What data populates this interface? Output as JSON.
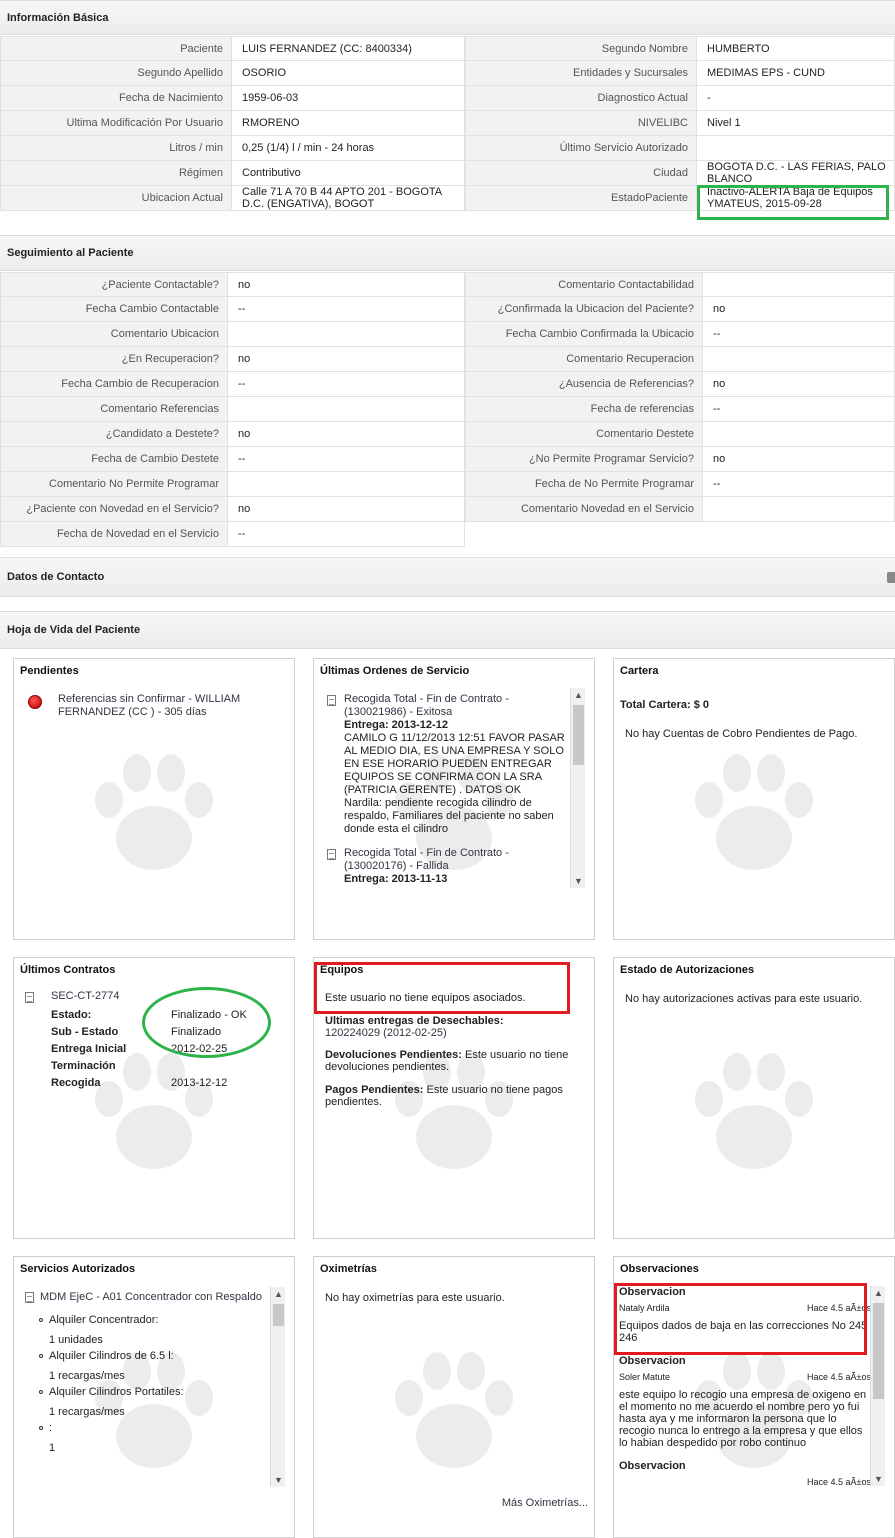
{
  "basic": {
    "header": "Información Básica",
    "rows": [
      {
        "l1": "Paciente",
        "v1": "LUIS FERNANDEZ (CC: 8400334)",
        "l2": "Segundo Nombre",
        "v2": "HUMBERTO"
      },
      {
        "l1": "Segundo Apellido",
        "v1": "OSORIO",
        "l2": "Entidades y Sucursales",
        "v2": "MEDIMAS EPS - CUND"
      },
      {
        "l1": "Fecha de Nacimiento",
        "v1": "1959-06-03",
        "l2": "Diagnostico Actual",
        "v2": "-"
      },
      {
        "l1": "Ultima Modificación Por Usuario",
        "v1": "RMORENO",
        "l2": "NIVELIBC",
        "v2": "Nivel 1"
      },
      {
        "l1": "Litros / min",
        "v1": "0,25 (1/4) l / min - 24 horas",
        "l2": "Último Servicio Autorizado",
        "v2": ""
      },
      {
        "l1": "Régimen",
        "v1": "Contributivo",
        "l2": "Ciudad",
        "v2": "BOGOTA D.C. - LAS FERIAS, PALO BLANCO"
      },
      {
        "l1": "Ubicacion Actual",
        "v1": "Calle 71 A 70 B 44 APTO 201 - BOGOTA D.C. (ENGATIVA), BOGOT",
        "l2": "EstadoPaciente",
        "v2": "Inactivo-ALERTA Baja de Equipos YMATEUS, 2015-09-28"
      }
    ]
  },
  "seguimiento": {
    "header": "Seguimiento al Paciente",
    "rows": [
      {
        "l1": "¿Paciente Contactable?",
        "v1": "no",
        "l2": "Comentario Contactabilidad",
        "v2": ""
      },
      {
        "l1": "Fecha Cambio Contactable",
        "v1": "--",
        "l2": "¿Confirmada la Ubicacion del Paciente?",
        "v2": "no"
      },
      {
        "l1": "Comentario Ubicacion",
        "v1": "",
        "l2": "Fecha Cambio Confirmada la Ubicacio",
        "v2": "--"
      },
      {
        "l1": "¿En Recuperacion?",
        "v1": "no",
        "l2": "Comentario Recuperacion",
        "v2": ""
      },
      {
        "l1": "Fecha Cambio de Recuperacion",
        "v1": "--",
        "l2": "¿Ausencia de Referencias?",
        "v2": "no"
      },
      {
        "l1": "Comentario Referencias",
        "v1": "",
        "l2": "Fecha de referencias",
        "v2": "--"
      },
      {
        "l1": "¿Candidato a Destete?",
        "v1": "no",
        "l2": "Comentario Destete",
        "v2": ""
      },
      {
        "l1": "Fecha de Cambio Destete",
        "v1": "--",
        "l2": "¿No Permite Programar Servicio?",
        "v2": "no"
      },
      {
        "l1": "Comentario No Permite Programar",
        "v1": "",
        "l2": "Fecha de No Permite Programar",
        "v2": "--"
      },
      {
        "l1": "¿Paciente con Novedad en el Servicio?",
        "v1": "no",
        "l2": "Comentario Novedad en el Servicio",
        "v2": ""
      },
      {
        "l1": "Fecha de Novedad en el Servicio",
        "v1": "--",
        "l2": "",
        "v2": ""
      }
    ]
  },
  "contacto": {
    "header": "Datos de Contacto"
  },
  "hoja": {
    "header": "Hoja de Vida del Paciente"
  },
  "pendientes": {
    "title": "Pendientes",
    "item": "Referencias sin Confirmar - WILLIAM FERNANDEZ (CC ) - 305 días"
  },
  "ordenes": {
    "title": "Últimas Ordenes de Servicio",
    "o1_title": "Recogida Total - Fin de Contrato - (130021986) - Exitosa",
    "o1_entrega": "Entrega: 2013-12-12",
    "o1_body": "CAMILO G 11/12/2013 12:51 FAVOR PASAR AL MEDIO DIA, ES UNA EMPRESA Y SOLO EN ESE HORARIO PUEDEN ENTREGAR EQUIPOS SE CONFIRMA CON LA SRA (PATRICIA GERENTE) . DATOS OK",
    "o1_body2": "Nardila: pendiente recogida cilindro de respaldo, Familiares del paciente no saben donde esta el cilindro",
    "o2_title": "Recogida Total - Fin de Contrato - (130020176) - Fallida",
    "o2_entrega": "Entrega: 2013-11-13"
  },
  "cartera": {
    "title": "Cartera",
    "total": "Total Cartera: $ 0",
    "msg": "No hay Cuentas de Cobro Pendientes de Pago."
  },
  "contratos": {
    "title": "Últimos Contratos",
    "code": "SEC-CT-2774",
    "k1": "Estado:",
    "v1": "Finalizado - OK",
    "k2": "Sub - Estado",
    "v2": "Finalizado",
    "k3": "Entrega Inicial",
    "v3": "2012-02-25",
    "k4": "Terminación",
    "v4": "",
    "k5": "Recogida",
    "v5": "2013-12-12"
  },
  "equipos": {
    "title": "Equipos",
    "msg": "Este usuario no tiene equipos asociados.",
    "des_label": "Ultimas entregas de Desechables:",
    "des_value": "120224029 (2012-02-25)",
    "dev_label": "Devoluciones Pendientes:",
    "dev_value": " Este usuario no tiene devoluciones pendientes.",
    "pag_label": "Pagos Pendientes:",
    "pag_value": " Este usuario no tiene pagos pendientes."
  },
  "autorizaciones": {
    "title": "Estado de Autorizaciones",
    "msg": "No hay autorizaciones activas para este usuario."
  },
  "servicios": {
    "title": "Servicios Autorizados",
    "plan": "MDM EjeC - A01 Concentrador con Respaldo",
    "items": [
      {
        "name": "Alquiler Concentrador:",
        "qty": "1 unidades"
      },
      {
        "name": "Alquiler Cilindros de 6.5 l:",
        "qty": "1 recargas/mes"
      },
      {
        "name": "Alquiler Cilindros Portatiles:",
        "qty": "1 recargas/mes"
      },
      {
        "name": ":",
        "qty": "1"
      }
    ]
  },
  "oximetrias": {
    "title": "Oximetrías",
    "msg": "No hay oximetrías para este usuario.",
    "more": "Más Oximetrías..."
  },
  "observaciones": {
    "title": "Observaciones",
    "o1_head": "Observacion",
    "o1_user": "Nataly Ardila",
    "o1_time": "Hace 4.5 aÃ±os",
    "o1_text": "Equipos dados de baja en las correcciones No 245 246",
    "o2_head": "Observacion",
    "o2_user": "Soler Matute",
    "o2_time": "Hace 4.5 aÃ±os",
    "o2_text": "este equipo lo recogio una empresa de oxigeno en el momento no me acuerdo el nombre pero yo fui hasta aya y me informaron la persona que lo recogio nunca lo entrego a la empresa y que ellos lo habian despedido por robo continuo",
    "o3_head": "Observacion",
    "o3_time": "Hace 4.5 aÃ±os"
  }
}
